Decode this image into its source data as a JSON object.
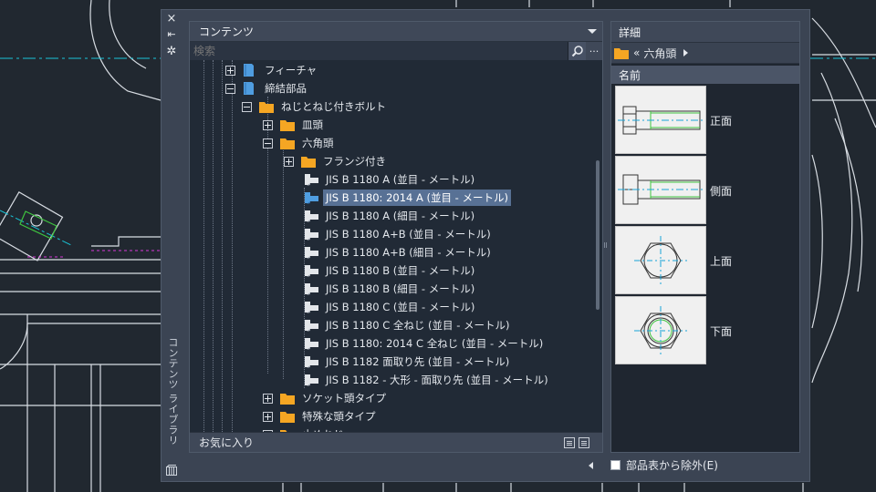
{
  "palette": {
    "title": "コンテンツ ライブラリ",
    "close_icon": "×",
    "pin_icon": "⇤",
    "settings_icon": "✲"
  },
  "content_pane": {
    "header": "コンテンツ",
    "search_placeholder": "検索",
    "more_label": "...",
    "tree": [
      {
        "label": "フィーチャ",
        "icon": "document-icon",
        "expander": "plus",
        "level": 0
      },
      {
        "label": "締結部品",
        "icon": "document-icon",
        "expander": "minus",
        "level": 0
      },
      {
        "label": "ねじとねじ付きボルト",
        "icon": "folder-icon",
        "expander": "minus",
        "level": 1
      },
      {
        "label": "皿頭",
        "icon": "folder-icon",
        "expander": "plus",
        "level": 2
      },
      {
        "label": "六角頭",
        "icon": "folder-icon",
        "expander": "minus",
        "level": 2
      },
      {
        "label": "フランジ付き",
        "icon": "folder-icon",
        "expander": "plus",
        "level": 3
      },
      {
        "label": "JIS B 1180  A  (並目 - メートル)",
        "icon": "bolt-icon",
        "level": 3
      },
      {
        "label": "JIS B 1180: 2014  A  (並目 - メートル)",
        "icon": "bolt-icon",
        "level": 3,
        "selected": true
      },
      {
        "label": "JIS B 1180  A  (細目 - メートル)",
        "icon": "bolt-icon",
        "level": 3
      },
      {
        "label": "JIS B 1180  A+B  (並目 - メートル)",
        "icon": "bolt-icon",
        "level": 3
      },
      {
        "label": "JIS B 1180  A+B  (細目 - メートル)",
        "icon": "bolt-icon",
        "level": 3
      },
      {
        "label": "JIS B 1180  B  (並目 - メートル)",
        "icon": "bolt-icon",
        "level": 3
      },
      {
        "label": "JIS B 1180  B  (細目 - メートル)",
        "icon": "bolt-icon",
        "level": 3
      },
      {
        "label": "JIS B 1180  C  (並目 - メートル)",
        "icon": "bolt-icon",
        "level": 3
      },
      {
        "label": "JIS B 1180  C  全ねじ  (並目 - メートル)",
        "icon": "bolt-icon",
        "level": 3
      },
      {
        "label": "JIS B 1180: 2014  C  全ねじ  (並目 - メートル)",
        "icon": "bolt-icon",
        "level": 3
      },
      {
        "label": "JIS B 1182  面取り先  (並目 - メートル)",
        "icon": "bolt-icon",
        "level": 3
      },
      {
        "label": "JIS B 1182 - 大形 - 面取り先  (並目 - メートル)",
        "icon": "bolt-icon",
        "level": 3
      },
      {
        "label": "ソケット頭タイプ",
        "icon": "folder-icon",
        "expander": "plus",
        "level": 2
      },
      {
        "label": "特殊な頭タイプ",
        "icon": "folder-icon",
        "expander": "plus",
        "level": 2
      },
      {
        "label": "止めねじ",
        "icon": "folder-icon",
        "expander": "plus",
        "level": 2
      }
    ],
    "favorites_label": "お気に入り"
  },
  "details_pane": {
    "header": "詳細",
    "breadcrumb_back": "«",
    "breadcrumb_label": "六角頭",
    "column_header": "名前",
    "views": [
      {
        "label": "正面",
        "kind": "front"
      },
      {
        "label": "側面",
        "kind": "side"
      },
      {
        "label": "上面",
        "kind": "top"
      },
      {
        "label": "下面",
        "kind": "bottom"
      }
    ],
    "exclude_label": "部品表から除外(E)",
    "exclude_checked": false
  },
  "colors": {
    "folder": "#f5a623",
    "document": "#4f9de0",
    "selection": "#587195",
    "cad_background": "#212830",
    "cad_cyan": "#19c4d8",
    "cad_magenta": "#d838d8"
  }
}
